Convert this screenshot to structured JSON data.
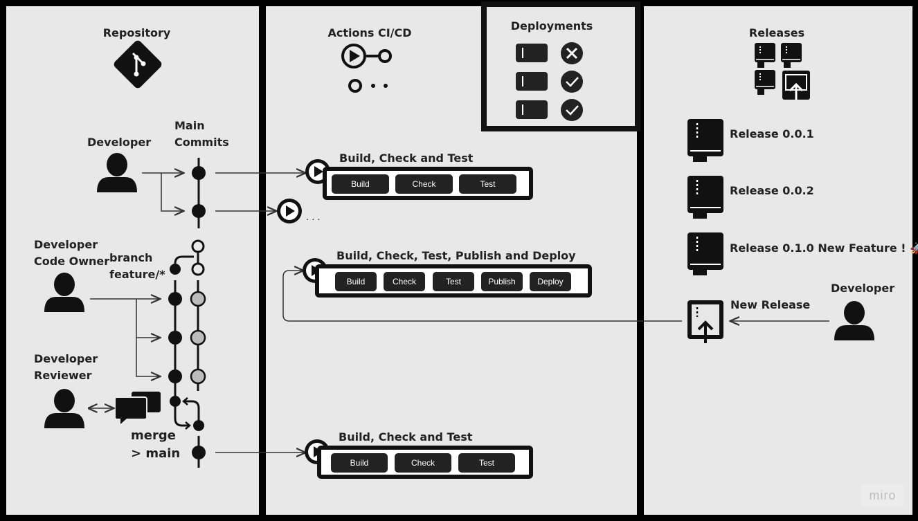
{
  "columns": {
    "repository": "Repository",
    "actions": "Actions CI/CD",
    "deployments": "Deployments",
    "releases": "Releases"
  },
  "left": {
    "developer": "Developer",
    "main_commits_1": "Main",
    "main_commits_2": "Commits",
    "code_owner_1": "Developer",
    "code_owner_2": "Code Owner",
    "branch_1": "branch",
    "branch_2": "feature/*",
    "reviewer_1": "Developer",
    "reviewer_2": "Reviewer",
    "merge_1": "merge",
    "merge_2": "> main"
  },
  "pipelines": [
    {
      "title": "Build, Check and Test",
      "steps": [
        "Build",
        "Check",
        "Test"
      ]
    },
    {
      "title": "Build, Check, Test, Publish and Deploy",
      "steps": [
        "Build",
        "Check",
        "Test",
        "Publish",
        "Deploy"
      ]
    },
    {
      "title": "Build, Check and Test",
      "steps": [
        "Build",
        "Check",
        "Test"
      ]
    }
  ],
  "ellipsis": ". . .",
  "releases": {
    "items": [
      "Release 0.0.1",
      "Release 0.0.2",
      "Release 0.1.0 New Feature ! 🚀"
    ],
    "new_release": "New Release",
    "developer": "Developer"
  },
  "watermark": "miro"
}
